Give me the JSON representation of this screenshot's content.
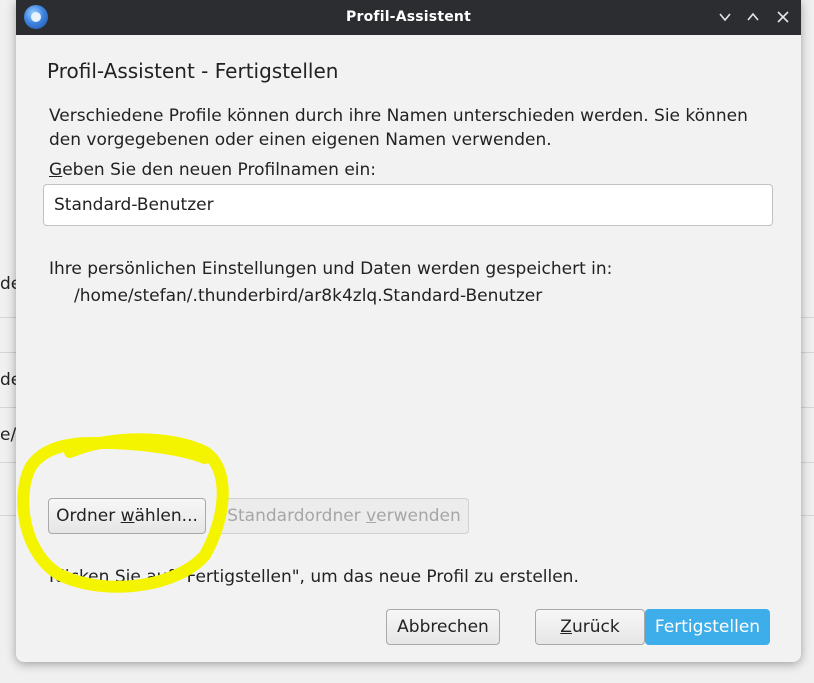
{
  "background": {
    "fragments": [
      "de",
      "de",
      "e/t"
    ]
  },
  "titlebar": {
    "title": "Profil-Assistent",
    "app_icon": "thunderbird-icon",
    "minimize_icon": "chevron-down-icon",
    "maximize_icon": "chevron-up-icon",
    "close_icon": "close-icon"
  },
  "dialog": {
    "heading": "Profil-Assistent - Fertigstellen",
    "intro_line1": "Verschiedene Profile können durch ihre Namen unterschieden werden. Sie können",
    "intro_line2": "den vorgegebenen oder einen eigenen Namen verwenden.",
    "name_label_accel": "G",
    "name_label_rest": "eben Sie den neuen Profilnamen ein:",
    "name_value": "Standard-Benutzer",
    "storage_label": "Ihre persönlichen Einstellungen und Daten werden gespeichert in:",
    "storage_path": "/home/stefan/.thunderbird/ar8k4zlq.Standard-Benutzer",
    "choose_folder_pre": "Ordner ",
    "choose_folder_accel": "w",
    "choose_folder_post": "ählen...",
    "default_folder_pre": "Standardordner ",
    "default_folder_accel": "v",
    "default_folder_post": "erwenden",
    "finish_hint": "Klicken Sie auf \"Fertigstellen\", um das neue Profil zu erstellen.",
    "cancel_label": "Abbrechen",
    "back_accel": "Z",
    "back_rest": "urück",
    "finish_label": "Fertigstellen"
  },
  "colors": {
    "titlebar_bg": "#2b2d30",
    "accent": "#3daee9",
    "annotation": "#f4f400"
  }
}
